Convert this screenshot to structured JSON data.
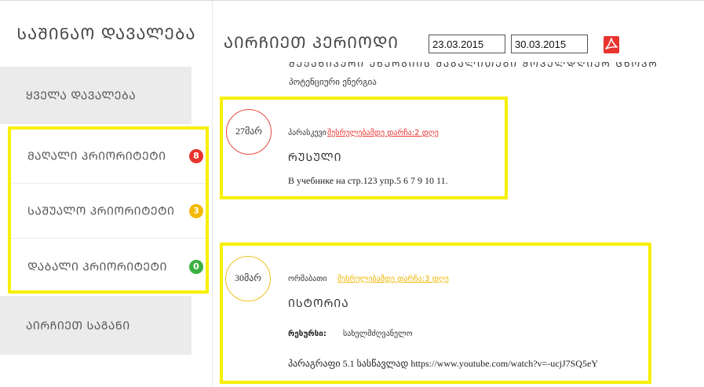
{
  "sidebar": {
    "title": "ᲡᲐᲨᲘᲜᲐᲝ ᲓᲐᲕᲐᲚᲔᲑᲐ",
    "all_tasks": "ᲧᲕᲔᲚᲐ ᲓᲐᲕᲐᲚᲔᲑᲐ",
    "priorities": [
      {
        "label": "ᲛᲐᲦᲐᲚᲘ ᲞᲠᲘᲝᲠᲘᲢᲔᲢᲘ",
        "count": "8",
        "color": "#e8342f"
      },
      {
        "label": "ᲡᲐᲨᲣᲐᲚᲝ ᲞᲠᲘᲝᲠᲘᲢᲔᲢᲘ",
        "count": "3",
        "color": "#f5b800"
      },
      {
        "label": "ᲓᲐᲑᲐᲚᲘ ᲞᲠᲘᲝᲠᲘᲢᲔᲢᲘ",
        "count": "0",
        "color": "#3cb043"
      }
    ],
    "choose_subject": "ᲐᲘᲠᲩᲘᲔᲗ ᲡᲐᲒᲐᲜᲘ"
  },
  "header": {
    "period_title": "ᲐᲘᲠᲩᲘᲔᲗ ᲞᲔᲠᲘᲝᲓᲘ",
    "date_from": "23.03.2015",
    "date_to": "30.03.2015",
    "pdf_icon": "pdf-icon"
  },
  "content": {
    "prev_cut_text": "ᲛᲔᲥᲐᲜᲘᲙᲣᲠᲘ ᲔᲜᲔᲠᲒᲘᲘᲡ ᲛᲐᲒᲐᲚᲘᲗᲔᲑᲘ ᲧᲝᲕᲔᲚᲓᲦᲘᲣᲠ ᲪᲮᲝᲕᲠᲔᲑᲐᲨᲘ",
    "prev_text": "პოტენციური ენერგია",
    "tasks": [
      {
        "date": "27მარ",
        "dayname": "პარასკევი",
        "deadline": "შესრულებამდე დარჩა:2 დღე",
        "deadline_color": "#e8342f",
        "subject": "ᲠᲣᲡᲣᲚᲘ",
        "description": "В учебнике на стр.123 упр.5 6 7 9 10 11."
      },
      {
        "date": "30მარ",
        "dayname": "ორშაბათი",
        "deadline": "შესრულებამდე დარჩა:3 დღე",
        "deadline_color": "#f0b400",
        "subject": "ᲘᲡᲢᲝᲠᲘᲐ",
        "resource_label": "რესურსი:",
        "resource_value": "სახელმძღვანელო",
        "description": "პარაგრაფი 5.1 სასწავლად https://www.youtube.com/watch?v=-ucjJ7SQ5eY"
      }
    ]
  }
}
